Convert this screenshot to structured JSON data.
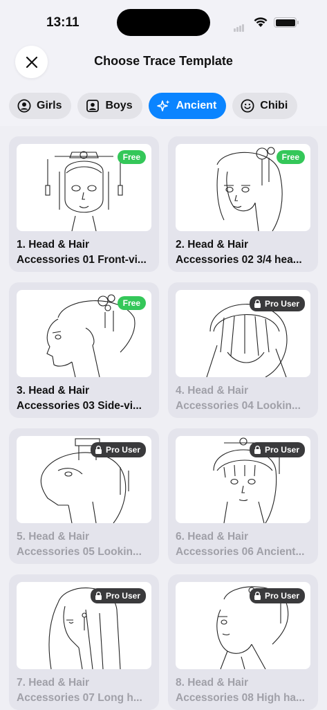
{
  "status": {
    "time": "13:11"
  },
  "header": {
    "title": "Choose Trace Template"
  },
  "tabs": [
    {
      "label": "Girls",
      "icon": "person-circle-icon"
    },
    {
      "label": "Boys",
      "icon": "person-square-icon"
    },
    {
      "label": "Ancient",
      "icon": "sparkles-icon",
      "selected": true
    },
    {
      "label": "Chibi",
      "icon": "smiley-icon"
    }
  ],
  "templates": [
    {
      "line1": "1. Head & Hair",
      "line2": "Accessories 01 Front-vi...",
      "badge": "Free",
      "locked": false
    },
    {
      "line1": "2. Head & Hair",
      "line2": "Accessories 02 3/4 hea...",
      "badge": "Free",
      "locked": false
    },
    {
      "line1": "3. Head & Hair",
      "line2": "Accessories 03 Side-vi...",
      "badge": "Free",
      "locked": false
    },
    {
      "line1": "4. Head & Hair",
      "line2": "Accessories 04 Lookin...",
      "badge": "Pro User",
      "locked": true
    },
    {
      "line1": "5. Head & Hair",
      "line2": "Accessories 05 Lookin...",
      "badge": "Pro User",
      "locked": true
    },
    {
      "line1": "6. Head & Hair",
      "line2": "Accessories 06 Ancient...",
      "badge": "Pro User",
      "locked": true
    },
    {
      "line1": "7. Head & Hair",
      "line2": "Accessories 07 Long h...",
      "badge": "Pro User",
      "locked": true
    },
    {
      "line1": "8. Head & Hair",
      "line2": "Accessories 08 High ha...",
      "badge": "Pro User",
      "locked": true
    }
  ],
  "colors": {
    "accent": "#0a84ff",
    "free": "#34c759",
    "pro": "#3a3a3c"
  }
}
